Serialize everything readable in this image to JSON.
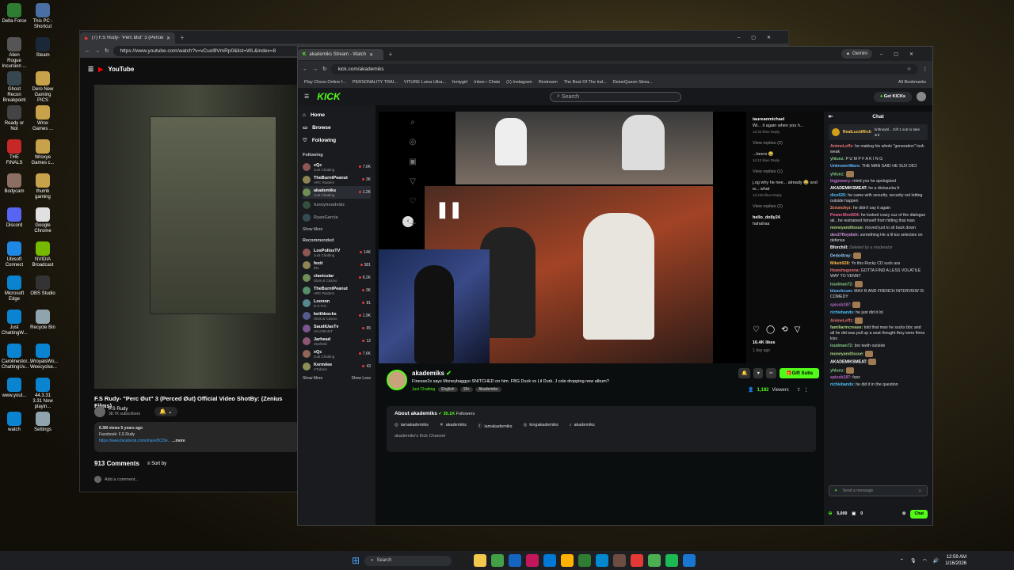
{
  "desktop": {
    "icons": [
      "Delta Force",
      "This PC - Shortcut",
      "Alien Rogue Incursion ...",
      "Steam",
      "Ghost Recon Breakpoint",
      "Dero New Gaming PICS",
      "Ready or Not",
      "Wrox Games ...",
      "THE FINALS",
      "Wroxye Games c...",
      "Bodycam",
      "thumb gaming",
      "Discord",
      "Google Chrome",
      "Ubisoft Connect",
      "NVIDIA Broadcast",
      "Microsoft Edge",
      "OBS Studio",
      "Just ChattingW...",
      "Recycle Bin",
      "Carolinestor... ChattingUv...",
      "WroyalsWo... Weecyclse...",
      "www.yout...",
      "44.3.31 3.31 Now playin...",
      "watch",
      "Settings"
    ]
  },
  "yt": {
    "tab_title": "(7) F.S Rudy- \"Perc Øut\" 3 (Perced",
    "url": "https://www.youtube.com/watch?v=vCuol9VmRp0&list=WL&index=8",
    "logo": "YouTube",
    "video_title": "F.S Rudy- \"Perc Øut\" 3 (Perced Øut) Official Video ShotBy: (Zenius Films)",
    "channel": "F.S Rudy",
    "subs": "38.7K subscribers",
    "desc_meta": "6.3M views  5 years ago",
    "desc_line1": "Facebook: F.S Rudy",
    "desc_link": "https://www.facebook.com/share/5Cf3e...",
    "desc_more": "...more",
    "comments": "913 Comments",
    "sort": "Sort by",
    "add_comment": "Add a comment..."
  },
  "kick": {
    "tab_title": "akademiks Stream - Watch",
    "url": "kick.com/akademiks",
    "gemini": "Gemini",
    "bookmarks": [
      "Play Chess Online f...",
      "PERSONALITY TRAI...",
      "VITURE Luma Ultra...",
      "fentygirl",
      "Inbox • Chats",
      "(1) Instagram",
      "Restream",
      "The Best Of The Ind...",
      "DeionQueen Strea...",
      "All Bookmarks"
    ],
    "logo": "KICK",
    "search_ph": "Search",
    "get_kicks": "Get KICKs",
    "nav": [
      "Home",
      "Browse",
      "Following"
    ],
    "following_label": "Following",
    "following": [
      {
        "name": "xQc",
        "game": "Just Chatting",
        "viewers": "7.6K"
      },
      {
        "name": "TheBurntPeanut",
        "game": "ARC Raiders",
        "viewers": "3K"
      },
      {
        "name": "akademiks",
        "game": "Just Chatting",
        "viewers": "1.2K"
      },
      {
        "name": "funnyhoodvidz",
        "game": "",
        "viewers": "off"
      },
      {
        "name": "RyanGarcia",
        "game": "",
        "viewers": "off"
      }
    ],
    "show_more": "Show More",
    "recommended_label": "Recommended",
    "recommended": [
      {
        "name": "LosPollosTV",
        "game": "Just Chatting",
        "viewers": "14K"
      },
      {
        "name": "fexit",
        "game": "IRL",
        "viewers": "381"
      },
      {
        "name": "clavicular",
        "game": "Slots & Casino",
        "viewers": "8.2K"
      },
      {
        "name": "TheBurntPeanut",
        "game": "ARC Raiders",
        "viewers": "3K"
      },
      {
        "name": "Loonnn",
        "game": "R.E.P.O.",
        "viewers": "81"
      },
      {
        "name": "keithbocks",
        "game": "Slots & Casino",
        "viewers": "1.9K"
      },
      {
        "name": "SaudiUasTv",
        "game": "VALORANT",
        "viewers": "65"
      },
      {
        "name": "Jarhead",
        "game": "Starfield",
        "viewers": "12"
      },
      {
        "name": "xQc",
        "game": "Just Chatting",
        "viewers": "7.6K"
      },
      {
        "name": "Kermiiee",
        "game": "VTubers",
        "viewers": "43"
      }
    ],
    "show_more2": "Show More",
    "show_less": "Show Less",
    "streamer": "akademiks",
    "stream_title": "Finesse2x says Moneybaggyo SNITCHED on him. FBG Duck vs Lil Durk. J cole dropping new album?",
    "category": "Just Chatting",
    "tags": [
      "English",
      "18+",
      "Akademiks"
    ],
    "gift_subs": "Gift Subs",
    "viewers": "1,182",
    "viewers_label": "Viewers",
    "about": "About akademiks",
    "followers": "35.1K",
    "followers_label": "Followers",
    "socials": [
      "iamakademiks",
      "akademiks",
      "iamakademiks",
      "kingakademiks",
      "akademiks"
    ],
    "channel_desc": "akademiks's Kick Channel",
    "overlay_comments": [
      {
        "user": "taureanmichael",
        "text": "Wi... it again when you h...",
        "meta": "1d  33 likes  Reply"
      },
      {
        "user": "",
        "text": "View replies (2)",
        "meta": ""
      },
      {
        "user": "",
        "text": "...beers 😂",
        "meta": "1d  12 likes  Reply"
      },
      {
        "user": "",
        "text": "View replies (1)",
        "meta": ""
      },
      {
        "user": "",
        "text": "j.og why he nee... already 😂 and w... what",
        "meta": "1d  239 likes  Reply"
      },
      {
        "user": "",
        "text": "View replies (2)",
        "meta": ""
      },
      {
        "user": "hello_dolly24",
        "text": "hahahaa",
        "meta": ""
      }
    ],
    "ig_likes": "16.4K likes",
    "ig_age": "1 day ago",
    "chat_title": "Chat",
    "pinned_user": "RealLucidRich",
    "pinned_text": "brittneybl... Gift 1 sub to take 3rd",
    "chat": [
      {
        "u": "AnimeLeffz",
        "c": "#e57373",
        "t": "he making his whole \"generation\" look weak"
      },
      {
        "u": "yhlunz",
        "c": "#81c784",
        "t": "P U M P F A K I N G"
      },
      {
        "u": "UnknownWave",
        "c": "#64b5f6",
        "t": "THE MAN SAID HE SUX DICI"
      },
      {
        "u": "yhlunz",
        "c": "#81c784",
        "t": ""
      },
      {
        "u": "bigjewwry",
        "c": "#ba68c8",
        "t": "mind you he apologized"
      },
      {
        "u": "AKADEMIKSMEAT",
        "c": "#fff",
        "t": "he a dickaucka fr"
      },
      {
        "u": "dice626",
        "c": "#4fc3f7",
        "t": "he came with security. security not letting outside happen"
      },
      {
        "u": "2crunchyz",
        "c": "#ff8a65",
        "t": "he didn't say it again"
      },
      {
        "u": "PowerShot504",
        "c": "#f06292",
        "t": "he looked crazy cuz of the dialogue ak , he restrained himself from hitting that man"
      },
      {
        "u": "moneyandtissue",
        "c": "#aed581",
        "t": "moved just to sit back down"
      },
      {
        "u": "dev27floydish",
        "c": "#ce93d8",
        "t": "something  He a lil too selective on defense"
      },
      {
        "u": "Bforchill",
        "c": "#fff",
        "t": "Deleted by a moderator"
      },
      {
        "u": "Dedo4tray",
        "c": "#90caf9",
        "t": ""
      },
      {
        "u": "Mikeb928",
        "c": "#ffb74d",
        "t": "Yo this Rocky CD suck ass"
      },
      {
        "u": "Howshegonna",
        "c": "#e57373",
        "t": "GOTTA FIND A LESS VOLATILE WAY TO VENNT"
      },
      {
        "u": "loudman72",
        "c": "#81c784",
        "t": ""
      },
      {
        "u": "bleachcum",
        "c": "#64b5f6",
        "t": "MAX B AND FRENCH INTERVIEW IS COMEDY"
      },
      {
        "u": "spissb187",
        "c": "#ba68c8",
        "t": ""
      },
      {
        "u": "richiebands",
        "c": "#4fc3f7",
        "t": "he just did it lol"
      },
      {
        "u": "AnimeLeffz",
        "c": "#e57373",
        "t": ""
      },
      {
        "u": "familiarincrease",
        "c": "#aed581",
        "t": "told that man he sucks bbc and all he did was pull up a seat thought they were finna kiss"
      },
      {
        "u": "loudman72",
        "c": "#81c784",
        "t": "bro teeth outside"
      },
      {
        "u": "moneyandtissue",
        "c": "#aed581",
        "t": ""
      },
      {
        "u": "AKADEMIKSMEAT",
        "c": "#fff",
        "t": ""
      },
      {
        "u": "yhlunz",
        "c": "#81c784",
        "t": ""
      },
      {
        "u": "spissb187",
        "c": "#ba68c8",
        "t": "faxx"
      },
      {
        "u": "richiebands",
        "c": "#4fc3f7",
        "t": "he did it in the question"
      }
    ],
    "send_ph": "Send a message",
    "balance1": "5,000",
    "balance2": "0",
    "chat_btn": "Chat"
  },
  "taskbar": {
    "search": "Search",
    "time": "12:59 AM",
    "date": "1/16/2026"
  }
}
